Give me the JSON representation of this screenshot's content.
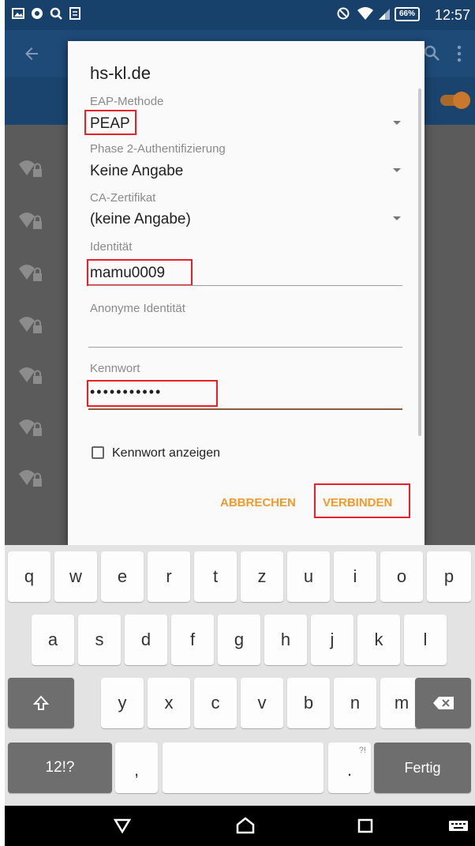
{
  "status_bar": {
    "time": "12:57",
    "battery": "66%",
    "icons": [
      "image-icon",
      "chrome-icon",
      "search-icon",
      "clipboard-icon",
      "block-icon",
      "wifi-icon",
      "signal-icon"
    ]
  },
  "dialog": {
    "title": "hs-kl.de",
    "eap_label": "EAP-Methode",
    "eap_value": "PEAP",
    "phase2_label": "Phase 2-Authentifizierung",
    "phase2_value": "Keine Angabe",
    "ca_label": "CA-Zertifikat",
    "ca_value": "(keine Angabe)",
    "identity_label": "Identität",
    "identity_value": "mamu0009",
    "anon_label": "Anonyme Identität",
    "anon_value": "",
    "password_label": "Kennwort",
    "password_value": "•••••••••••",
    "show_password_label": "Kennwort anzeigen",
    "show_password_checked": false,
    "cancel_label": "ABBRECHEN",
    "connect_label": "VERBINDEN",
    "highlight_color": "#e8202a",
    "accent_color": "#f39a2b"
  },
  "keyboard": {
    "row1": [
      "q",
      "w",
      "e",
      "r",
      "t",
      "z",
      "u",
      "i",
      "o",
      "p"
    ],
    "row2": [
      "a",
      "s",
      "d",
      "f",
      "g",
      "h",
      "j",
      "k",
      "l"
    ],
    "row3": [
      "y",
      "x",
      "c",
      "v",
      "b",
      "n",
      "m"
    ],
    "shift_icon": "shift-icon",
    "backspace_icon": "backspace-icon",
    "symbols_label": "12!?",
    "comma_label": ",",
    "period_label": ".",
    "period_hint": "?!",
    "done_label": "Fertig"
  },
  "nav_bar": {
    "icons": [
      "back-icon",
      "home-icon",
      "recents-icon",
      "keyboard-icon"
    ]
  },
  "colors": {
    "status_bar": "#17406a",
    "app_bar": "#1e4a78",
    "scrim": "#575757"
  }
}
